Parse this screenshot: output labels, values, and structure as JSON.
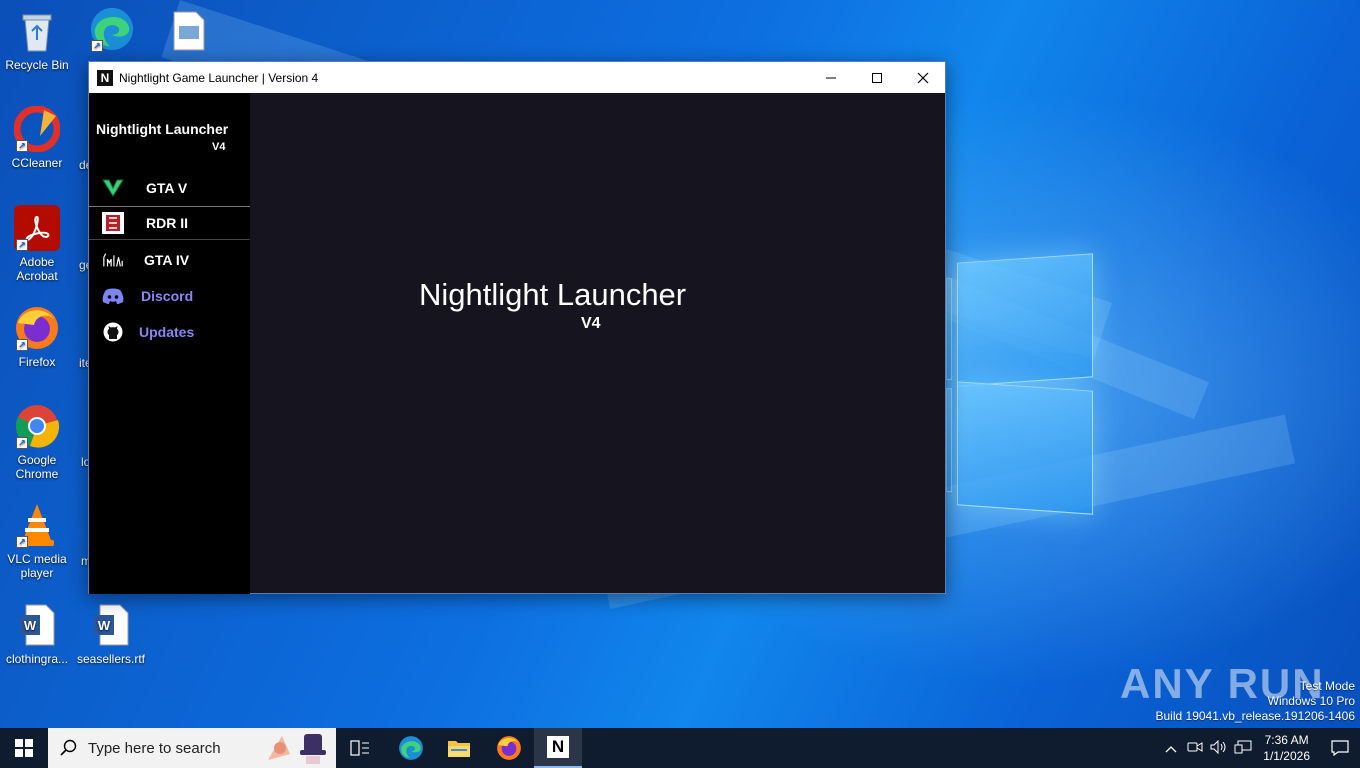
{
  "desktop": {
    "icons": [
      {
        "label": "Recycle Bin"
      },
      {
        "label": "CCleaner"
      },
      {
        "label": "Adobe Acrobat"
      },
      {
        "label": "Firefox"
      },
      {
        "label": "Google Chrome"
      },
      {
        "label": "VLC media player"
      },
      {
        "label": "clothingra..."
      },
      {
        "label": "seasellers.rtf"
      }
    ],
    "partial_labels": [
      "de",
      "ge",
      "ite",
      "lo",
      "m"
    ]
  },
  "window": {
    "title": "Nightlight Game Launcher | Version 4",
    "app_icon_letter": "N",
    "controls": {
      "minimize": "—",
      "maximize": "☐",
      "close": "✕"
    }
  },
  "sidebar": {
    "title": "Nightlight Launcher",
    "version": "V4",
    "items": [
      {
        "label": "GTA V",
        "icon": "gta-v-icon"
      },
      {
        "label": "RDR II",
        "icon": "rdr2-icon"
      },
      {
        "label": "GTA IV",
        "icon": "gta-iv-icon"
      },
      {
        "label": "Discord",
        "icon": "discord-icon"
      },
      {
        "label": "Updates",
        "icon": "github-icon"
      }
    ],
    "selected_index": 1
  },
  "main": {
    "title": "Nightlight Launcher",
    "version": "V4"
  },
  "watermark": {
    "text": "ANY RUN"
  },
  "os_info": {
    "line1": "Test Mode",
    "line2": "Windows 10 Pro",
    "line3": "Build 19041.vb_release.191206-1406"
  },
  "taskbar": {
    "search_placeholder": "Type here to search",
    "clock_time": "7:36 AM",
    "clock_date": "1/1/2026",
    "pinned": [
      "task-view-icon",
      "edge-icon",
      "file-explorer-icon",
      "firefox-icon",
      "nightlight-icon"
    ],
    "active_app_letter": "N"
  },
  "colors": {
    "window_bg": "#16141f",
    "sidebar_bg": "#000000",
    "link_color": "#8a86f2",
    "taskbar_bg": "#0f1b2e"
  }
}
